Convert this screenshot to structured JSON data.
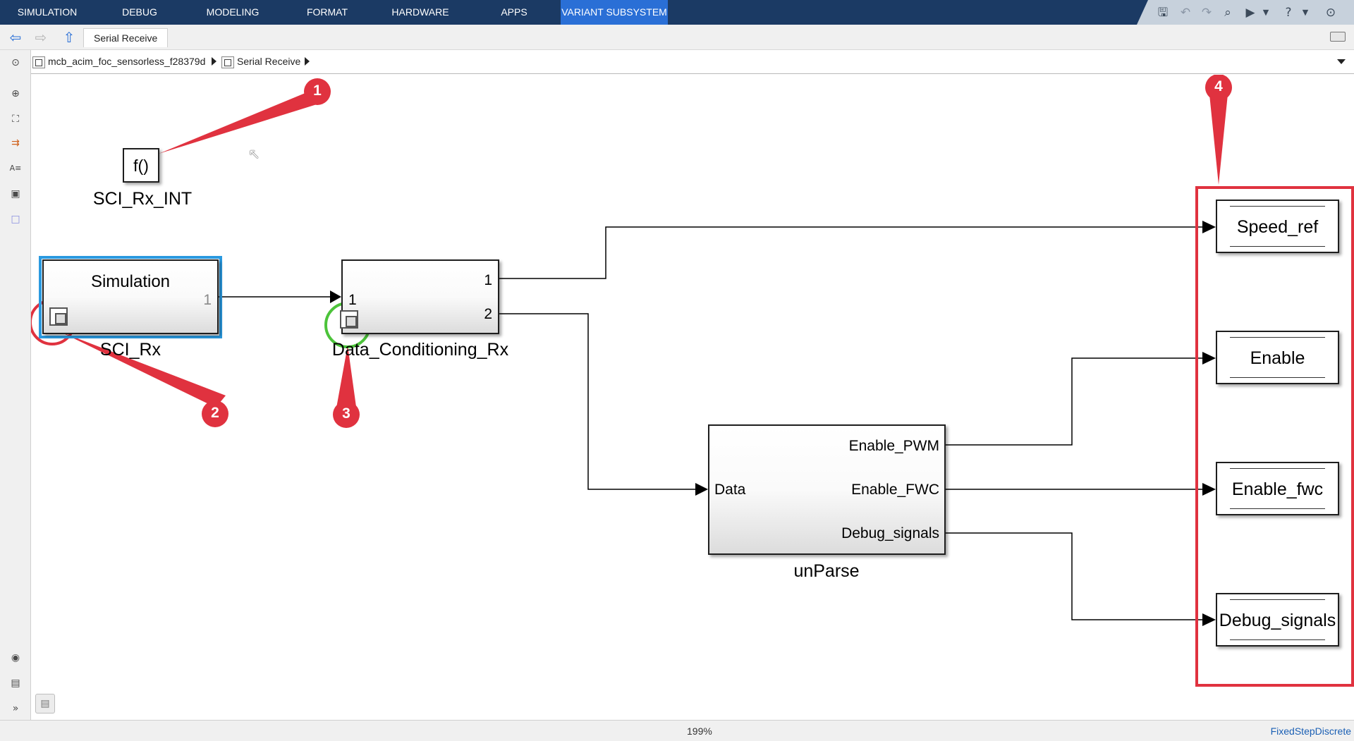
{
  "ribbon": {
    "tabs": [
      {
        "label": "SIMULATION",
        "active": false
      },
      {
        "label": "DEBUG",
        "active": false
      },
      {
        "label": "MODELING",
        "active": false
      },
      {
        "label": "FORMAT",
        "active": false
      },
      {
        "label": "HARDWARE",
        "active": false
      },
      {
        "label": "APPS",
        "active": false
      },
      {
        "label": "VARIANT SUBSYSTEM",
        "active": true
      }
    ],
    "quick_access_icons": [
      "save-icon",
      "undo-icon",
      "redo-icon",
      "find-icon",
      "run-icon",
      "help-icon",
      "minimize-ribbon-icon"
    ],
    "colors": {
      "ribbon_bg": "#1b3a64",
      "active_tab": "#2a6fd6"
    }
  },
  "nav": {
    "model_tab": "Serial Receive",
    "buttons": [
      "back-arrow-icon",
      "forward-arrow-icon",
      "up-arrow-icon"
    ]
  },
  "breadcrumb": {
    "items": [
      "mcb_acim_foc_sensorless_f28379d",
      "Serial Receive"
    ]
  },
  "palette": {
    "icons": [
      "hide-explorer-icon",
      "zoom-icon",
      "fit-view-icon",
      "signal-routing-icon",
      "annotation-icon",
      "image-icon",
      "area-icon",
      "screenshot-icon",
      "model-browser-icon",
      "expand-icon",
      "data-view-icon"
    ]
  },
  "diagram": {
    "fcn_block": {
      "symbol": "f()",
      "label": "SCI_Rx_INT"
    },
    "sci_rx": {
      "title": "Simulation",
      "out_port": "1",
      "label": "SCI_Rx"
    },
    "data_conditioning": {
      "in_port": "1",
      "out_port_1": "1",
      "out_port_2": "2",
      "label": "Data_Conditioning_Rx"
    },
    "unparse": {
      "in_port": "Data",
      "out_1": "Enable_PWM",
      "out_2": "Enable_FWC",
      "out_3": "Debug_signals",
      "label": "unParse"
    },
    "outports": [
      "Speed_ref",
      "Enable",
      "Enable_fwc",
      "Debug_signals"
    ],
    "annotations": [
      "1",
      "2",
      "3",
      "4"
    ],
    "annotation_color": "#e0323f",
    "highlight_green": "#4cc33a",
    "highlight_blue": "#2a9ae0"
  },
  "status": {
    "zoom": "199%",
    "solver": "FixedStepDiscrete"
  }
}
